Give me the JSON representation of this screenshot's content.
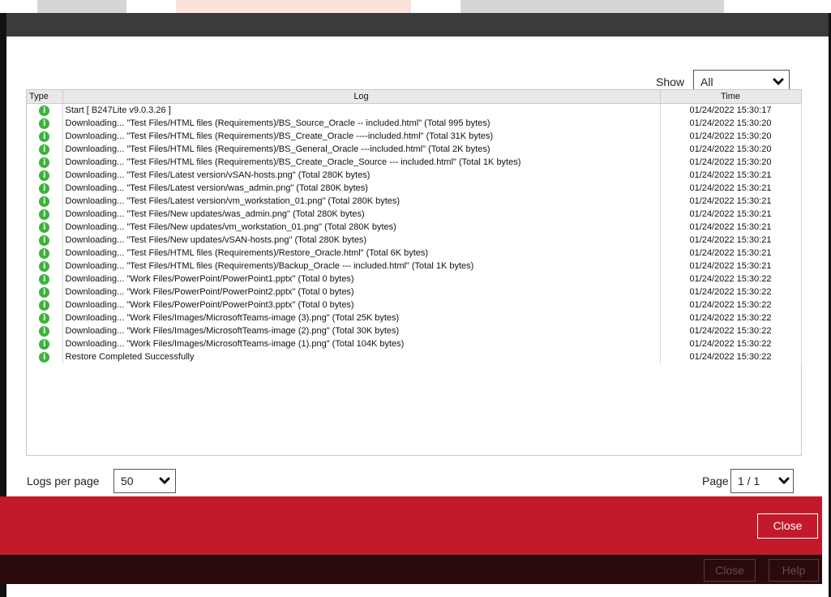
{
  "show": {
    "label": "Show",
    "value": "All"
  },
  "columns": {
    "type": "Type",
    "log": "Log",
    "time": "Time"
  },
  "rows": [
    {
      "log": "Start [ B247Lite  v9.0.3.26 ]",
      "time": "01/24/2022 15:30:17"
    },
    {
      "log": "Downloading... \"Test Files/HTML files (Requirements)/BS_Source_Oracle -- included.html\" (Total 995 bytes)",
      "time": "01/24/2022 15:30:20"
    },
    {
      "log": "Downloading... \"Test Files/HTML files (Requirements)/BS_Create_Oracle ----included.html\" (Total 31K bytes)",
      "time": "01/24/2022 15:30:20"
    },
    {
      "log": "Downloading... \"Test Files/HTML files (Requirements)/BS_General_Oracle ---included.html\" (Total 2K bytes)",
      "time": "01/24/2022 15:30:20"
    },
    {
      "log": "Downloading... \"Test Files/HTML files (Requirements)/BS_Create_Oracle_Source --- included.html\" (Total 1K bytes)",
      "time": "01/24/2022 15:30:20"
    },
    {
      "log": "Downloading... \"Test Files/Latest version/vSAN-hosts.png\" (Total 280K bytes)",
      "time": "01/24/2022 15:30:21"
    },
    {
      "log": "Downloading... \"Test Files/Latest version/was_admin.png\" (Total 280K bytes)",
      "time": "01/24/2022 15:30:21"
    },
    {
      "log": "Downloading... \"Test Files/Latest version/vm_workstation_01.png\" (Total 280K bytes)",
      "time": "01/24/2022 15:30:21"
    },
    {
      "log": "Downloading... \"Test Files/New updates/was_admin.png\" (Total 280K bytes)",
      "time": "01/24/2022 15:30:21"
    },
    {
      "log": "Downloading... \"Test Files/New updates/vm_workstation_01.png\" (Total 280K bytes)",
      "time": "01/24/2022 15:30:21"
    },
    {
      "log": "Downloading... \"Test Files/New updates/vSAN-hosts.png\" (Total 280K bytes)",
      "time": "01/24/2022 15:30:21"
    },
    {
      "log": "Downloading... \"Test Files/HTML files (Requirements)/Restore_Oracle.html\" (Total 6K bytes)",
      "time": "01/24/2022 15:30:21"
    },
    {
      "log": "Downloading... \"Test Files/HTML files (Requirements)/Backup_Oracle --- included.html\" (Total 1K bytes)",
      "time": "01/24/2022 15:30:21"
    },
    {
      "log": "Downloading... \"Work Files/PowerPoint/PowerPoint1.pptx\" (Total 0 bytes)",
      "time": "01/24/2022 15:30:22"
    },
    {
      "log": "Downloading... \"Work Files/PowerPoint/PowerPoint2.pptx\" (Total 0 bytes)",
      "time": "01/24/2022 15:30:22"
    },
    {
      "log": "Downloading... \"Work Files/PowerPoint/PowerPoint3.pptx\" (Total 0 bytes)",
      "time": "01/24/2022 15:30:22"
    },
    {
      "log": "Downloading... \"Work Files/Images/MicrosoftTeams-image (3).png\" (Total 25K bytes)",
      "time": "01/24/2022 15:30:22"
    },
    {
      "log": "Downloading... \"Work Files/Images/MicrosoftTeams-image (2).png\" (Total 30K bytes)",
      "time": "01/24/2022 15:30:22"
    },
    {
      "log": "Downloading... \"Work Files/Images/MicrosoftTeams-image (1).png\" (Total 104K bytes)",
      "time": "01/24/2022 15:30:22"
    },
    {
      "log": "Restore Completed Successfully",
      "time": "01/24/2022 15:30:22"
    }
  ],
  "row_icon": "info-icon",
  "icon_glyph": "i",
  "logs_per_page": {
    "label": "Logs per page",
    "value": "50"
  },
  "page": {
    "label": "Page",
    "value": "1 / 1"
  },
  "buttons": {
    "close": "Close",
    "bg_close": "Close",
    "bg_help": "Help"
  },
  "colors": {
    "footer": "#c21a2b",
    "info": "#3bb33b",
    "header": "#3b3b3b"
  }
}
